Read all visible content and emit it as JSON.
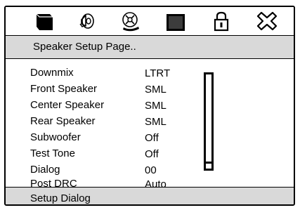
{
  "tabs": [
    {
      "icon": "general-setup-icon"
    },
    {
      "icon": "speaker-setup-icon"
    },
    {
      "icon": "audio-disc-icon"
    },
    {
      "icon": "video-setup-icon"
    },
    {
      "icon": "lock-icon"
    },
    {
      "icon": "exit-icon"
    }
  ],
  "page": {
    "title": "Speaker Setup Page.."
  },
  "settings": [
    {
      "label": "Downmix",
      "value": "LTRT"
    },
    {
      "label": "Front Speaker",
      "value": "SML"
    },
    {
      "label": "Center Speaker",
      "value": "SML"
    },
    {
      "label": "Rear Speaker",
      "value": "SML"
    },
    {
      "label": "Subwoofer",
      "value": "Off"
    },
    {
      "label": "Test Tone",
      "value": "Off"
    },
    {
      "label": "Dialog",
      "value": "00"
    },
    {
      "label": "Post DRC",
      "value": "Auto"
    }
  ],
  "scroll": {
    "position": 1.0
  },
  "footer": {
    "text": "Setup Dialog"
  },
  "colors": {
    "header_bg": "#d9d9d9",
    "border": "#000000"
  }
}
